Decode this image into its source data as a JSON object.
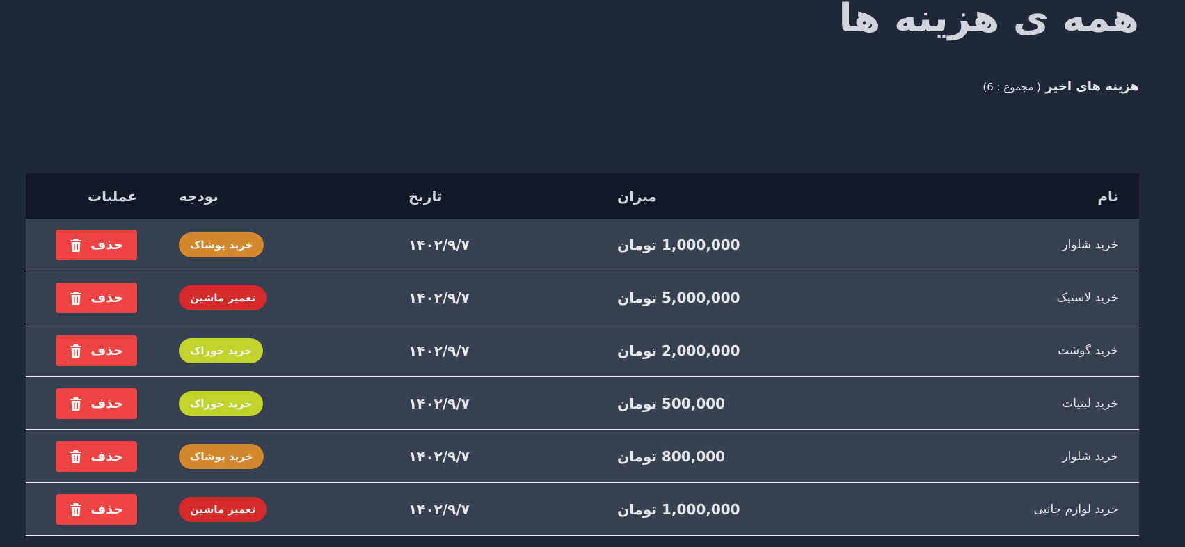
{
  "page": {
    "title": "همه ی هزینه ها",
    "subtitle": "هزینه های اخیر",
    "total_label": "( مجموع : 6)"
  },
  "table": {
    "headers": {
      "name": "نام",
      "amount": "میزان",
      "date": "تاریخ",
      "budget": "بودجه",
      "ops": "عملیات"
    },
    "delete_label": "حذف",
    "rows": [
      {
        "name": "خرید شلوار",
        "amount": "1,000,000 تومان",
        "date": "۱۴۰۲/۹/۷",
        "budget": "خرید پوشاک",
        "budget_color": "#d4872b"
      },
      {
        "name": "خرید لاستیک",
        "amount": "5,000,000 تومان",
        "date": "۱۴۰۲/۹/۷",
        "budget": "تعمیر ماشین",
        "budget_color": "#d62b2b"
      },
      {
        "name": "خرید گوشت",
        "amount": "2,000,000 تومان",
        "date": "۱۴۰۲/۹/۷",
        "budget": "خرید خوراک",
        "budget_color": "#c1d42b"
      },
      {
        "name": "خرید لبنیات",
        "amount": "500,000 تومان",
        "date": "۱۴۰۲/۹/۷",
        "budget": "خرید خوراک",
        "budget_color": "#c1d42b"
      },
      {
        "name": "خرید شلوار",
        "amount": "800,000 تومان",
        "date": "۱۴۰۲/۹/۷",
        "budget": "خرید پوشاک",
        "budget_color": "#d4872b"
      },
      {
        "name": "خرید لوازم جانبی",
        "amount": "1,000,000 تومان",
        "date": "۱۴۰۲/۹/۷",
        "budget": "تعمیر ماشین",
        "budget_color": "#d62b2b"
      }
    ]
  },
  "colors": {
    "background": "#1f2839",
    "header_bg": "#111827",
    "row_bg": "#374151",
    "delete_button": "#ef4444"
  },
  "icons": {
    "delete": "trash-icon"
  }
}
